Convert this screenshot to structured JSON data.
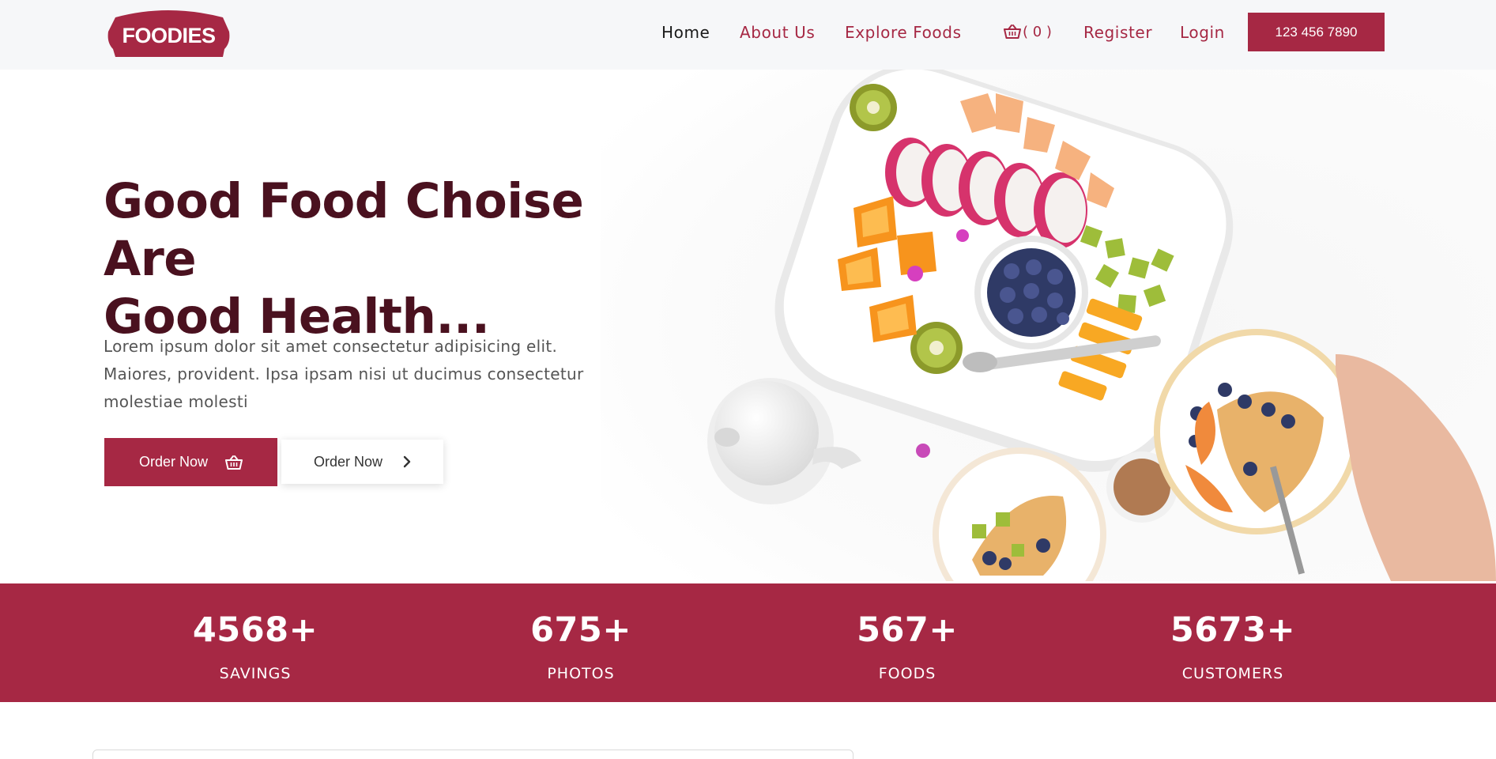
{
  "brand": {
    "name": "FOODIES",
    "color": "#a62844"
  },
  "nav": {
    "home": "Home",
    "about": "About Us",
    "explore": "Explore Foods",
    "cart_label": "( 0 )",
    "cart_icon": "basket-icon",
    "register": "Register",
    "login": "Login",
    "phone": "123 456 7890"
  },
  "hero": {
    "title_line1": "Good Food Choise Are",
    "title_line2": "Good Health...",
    "description": "Lorem ipsum dolor sit amet consectetur adipisicing elit. Maiores, provident. Ipsa ipsam nisi ut ducimus consectetur molestiae molesti",
    "primary_button": "Order Now",
    "primary_icon": "basket-icon",
    "secondary_button": "Order Now",
    "secondary_icon": "chevron-right-icon"
  },
  "stats": [
    {
      "value": "4568+",
      "label": "SAVINGS"
    },
    {
      "value": "675+",
      "label": "PHOTOS"
    },
    {
      "value": "567+",
      "label": "FOODS"
    },
    {
      "value": "5673+",
      "label": "CUSTOMERS"
    }
  ]
}
